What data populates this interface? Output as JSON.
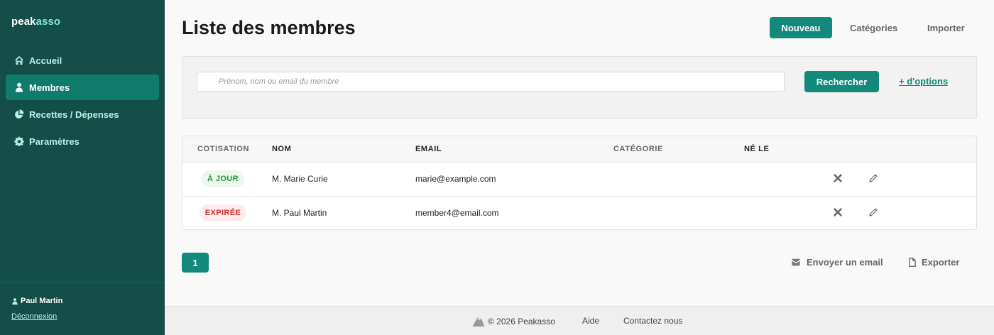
{
  "brand": {
    "part1": "peak",
    "part2": "asso"
  },
  "sidebar": {
    "items": [
      {
        "label": "Accueil",
        "icon": "home-icon"
      },
      {
        "label": "Membres",
        "icon": "person-icon"
      },
      {
        "label": "Recettes / Dépenses",
        "icon": "pie-chart-icon"
      },
      {
        "label": "Paramètres",
        "icon": "gear-icon"
      }
    ],
    "active": "Membres",
    "user_name": "Paul Martin",
    "logout_label": "Déconnexion"
  },
  "header": {
    "title": "Liste des membres",
    "new_button": "Nouveau",
    "categories_link": "Catégories",
    "import_link": "Importer"
  },
  "search": {
    "placeholder": "Prénom, nom ou email du membre",
    "value": "",
    "button": "Rechercher",
    "more_options": "+ d'options"
  },
  "table": {
    "columns": [
      "COTISATION",
      "NOM",
      "EMAIL",
      "CATÉGORIE",
      "NÉ LE"
    ],
    "rows": [
      {
        "status": "À JOUR",
        "status_type": "ok",
        "name": "M. Marie Curie",
        "email": "marie@example.com",
        "category": "",
        "born": ""
      },
      {
        "status": "EXPIRÉE",
        "status_type": "expired",
        "name": "M. Paul Martin",
        "email": "member4@email.com",
        "category": "",
        "born": ""
      }
    ]
  },
  "pagination": {
    "current_page": "1"
  },
  "actions": {
    "send_email": "Envoyer un email",
    "export": "Exporter"
  },
  "footer": {
    "copyright": "© 2026 Peakasso",
    "help": "Aide",
    "contact": "Contactez nous"
  },
  "colors": {
    "sidebar": "#134e48",
    "accent": "#12897a",
    "active_item": "#0f7b6c",
    "ok": "#1e9b3a",
    "expired": "#d22f2f"
  }
}
